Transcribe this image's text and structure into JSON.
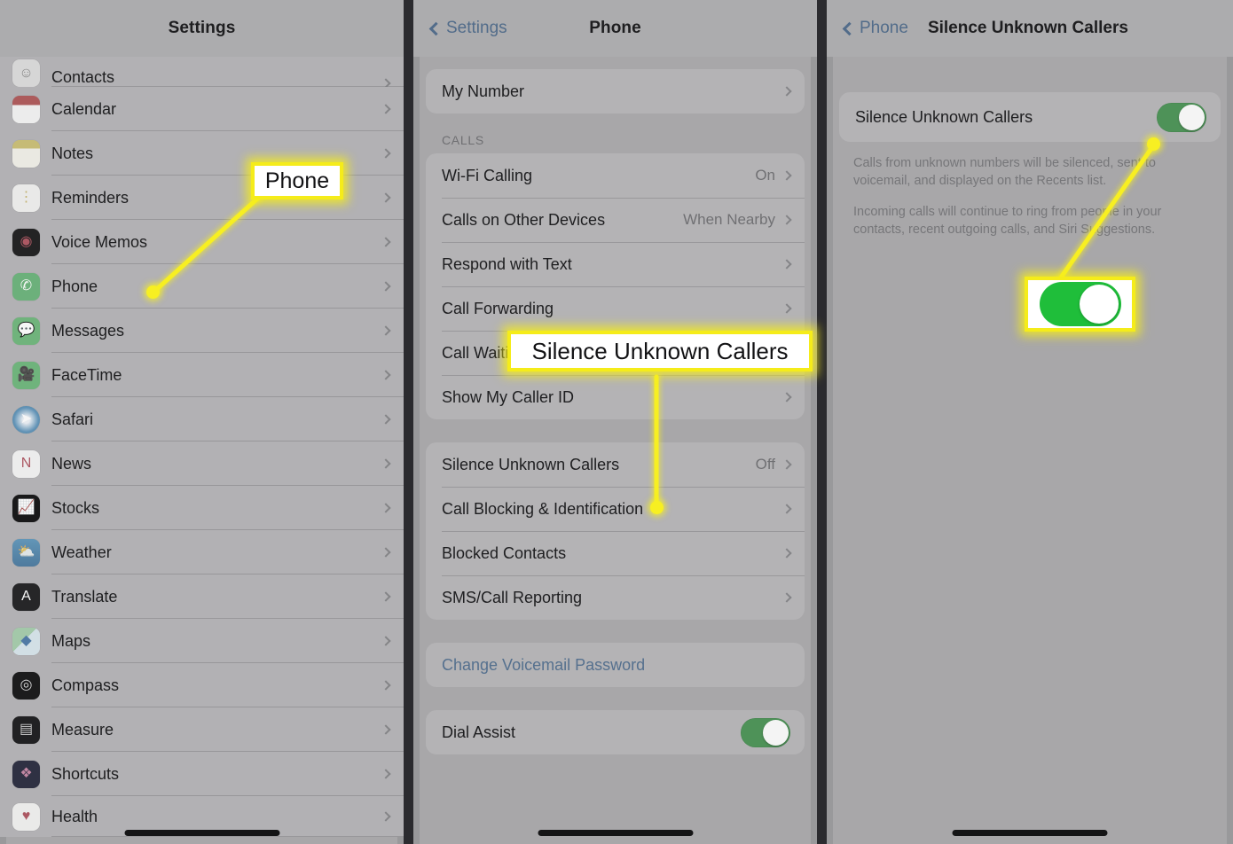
{
  "panels": {
    "settings": {
      "nav_title": "Settings",
      "items": [
        {
          "label": "Contacts",
          "icon": "contacts-app-icon",
          "clipped": true
        },
        {
          "label": "Calendar",
          "icon": "calendar-app-icon"
        },
        {
          "label": "Notes",
          "icon": "notes-app-icon"
        },
        {
          "label": "Reminders",
          "icon": "reminders-app-icon"
        },
        {
          "label": "Voice Memos",
          "icon": "voice-memos-app-icon"
        },
        {
          "label": "Phone",
          "icon": "phone-app-icon"
        },
        {
          "label": "Messages",
          "icon": "messages-app-icon"
        },
        {
          "label": "FaceTime",
          "icon": "facetime-app-icon"
        },
        {
          "label": "Safari",
          "icon": "safari-app-icon"
        },
        {
          "label": "News",
          "icon": "news-app-icon"
        },
        {
          "label": "Stocks",
          "icon": "stocks-app-icon"
        },
        {
          "label": "Weather",
          "icon": "weather-app-icon"
        },
        {
          "label": "Translate",
          "icon": "translate-app-icon"
        },
        {
          "label": "Maps",
          "icon": "maps-app-icon"
        },
        {
          "label": "Compass",
          "icon": "compass-app-icon"
        },
        {
          "label": "Measure",
          "icon": "measure-app-icon"
        },
        {
          "label": "Shortcuts",
          "icon": "shortcuts-app-icon"
        },
        {
          "label": "Health",
          "icon": "health-app-icon"
        }
      ]
    },
    "phone": {
      "nav_back_label": "Settings",
      "nav_title": "Phone",
      "my_number_label": "My Number",
      "calls_header": "CALLS",
      "calls_rows": [
        {
          "label": "Wi-Fi Calling",
          "value": "On"
        },
        {
          "label": "Calls on Other Devices",
          "value": "When Nearby"
        },
        {
          "label": "Respond with Text",
          "value": ""
        },
        {
          "label": "Call Forwarding",
          "value": ""
        },
        {
          "label": "Call Waiting",
          "value": ""
        },
        {
          "label": "Show My Caller ID",
          "value": ""
        }
      ],
      "blocking_rows": [
        {
          "label": "Silence Unknown Callers",
          "value": "Off"
        },
        {
          "label": "Call Blocking & Identification",
          "value": ""
        },
        {
          "label": "Blocked Contacts",
          "value": ""
        },
        {
          "label": "SMS/Call Reporting",
          "value": ""
        }
      ],
      "voicemail_label": "Change Voicemail Password",
      "dial_assist_label": "Dial Assist",
      "dial_assist_state": "on"
    },
    "silence": {
      "nav_back_label": "Phone",
      "nav_title": "Silence Unknown Callers",
      "toggle_label": "Silence Unknown Callers",
      "toggle_state": "on",
      "description_1": "Calls from unknown numbers will be silenced, sent to voicemail, and displayed on the Recents list.",
      "description_2": "Incoming calls will continue to ring from people in your contacts, recent outgoing calls, and Siri Suggestions."
    }
  },
  "annotations": {
    "callout_phone": "Phone",
    "callout_silence": "Silence Unknown Callers",
    "callout_toggle_icon": "toggle-switch-on-icon"
  },
  "colors": {
    "accent_yellow": "#f5ec1a",
    "toggle_green": "#1fa432",
    "link_blue": "#3d72ad",
    "page_bg": "#abaaae",
    "card_bg": "#b8b7bb"
  }
}
